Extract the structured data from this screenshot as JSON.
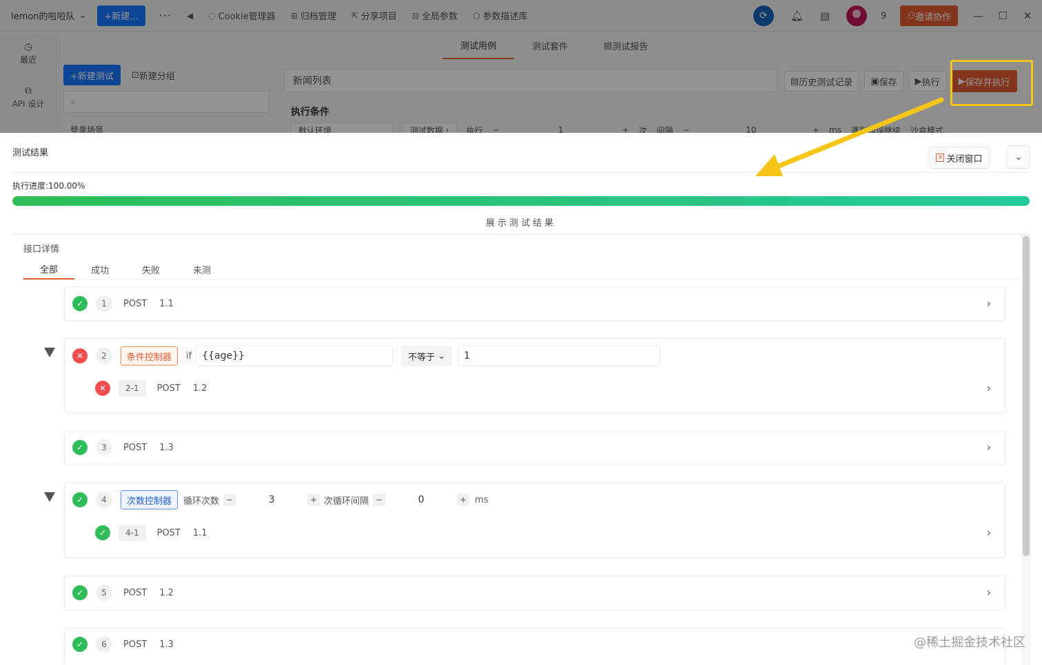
{
  "topbar": {
    "team_name": "lemon的啦啦队",
    "new_button": "+新建...",
    "more": "···",
    "nav": [
      {
        "icon": "cookie-icon",
        "glyph": "◌",
        "label": "Cookie管理器"
      },
      {
        "icon": "archive-icon",
        "glyph": "⊞",
        "label": "归档管理"
      },
      {
        "icon": "share-icon",
        "glyph": "⇱",
        "label": "分享项目"
      },
      {
        "icon": "global-params-icon",
        "glyph": "⊟",
        "label": "全局参数"
      },
      {
        "icon": "cube-icon",
        "glyph": "⬡",
        "label": "参数描述库"
      }
    ],
    "user_count": "9",
    "invite_button": "邀请协作"
  },
  "rail": {
    "items": [
      {
        "icon": "clock-icon",
        "label": "最近"
      },
      {
        "icon": "edit-icon",
        "label": "API 设计"
      }
    ]
  },
  "behind": {
    "tabs": [
      "测试用例",
      "测试套件",
      "测试报告"
    ],
    "new_test_button": "+新建测试",
    "new_group_button": "新建分组",
    "scene_item": "登录场景",
    "test_name": "新闻列表",
    "history_button": "历史测试记录",
    "save_button": "保存",
    "run_button": "执行",
    "save_run_button": "保存并执行",
    "conditions_title": "执行条件",
    "env_select": "默认环境",
    "test_data": "测试数据",
    "run_label": "执行",
    "run_times": "1",
    "times_unit": "次",
    "interval_label": "间隔",
    "interval_value": "10",
    "interval_unit": "ms",
    "continue_on_error": "遇到错误继续",
    "sandbox_mode": "沙盒模式"
  },
  "result": {
    "title": "测试结果",
    "close_button": "关闭窗口",
    "progress_label": "执行进度:100.00%",
    "progress_value": 1.0,
    "show_result": "展示测试结果",
    "detail_title": "接口详情",
    "tabs": [
      "全部",
      "成功",
      "失败",
      "未测"
    ],
    "items": [
      {
        "status": "success",
        "index": "1",
        "method": "POST",
        "name": "1.1"
      },
      {
        "status": "fail",
        "index": "2",
        "controller": "条件控制器",
        "if_label": "if",
        "condition_var": "{{age}}",
        "operator": "不等于",
        "compare_value": "1",
        "child": {
          "status": "fail",
          "index": "2-1",
          "method": "POST",
          "name": "1.2"
        }
      },
      {
        "status": "success",
        "index": "3",
        "method": "POST",
        "name": "1.3"
      },
      {
        "status": "success",
        "index": "4",
        "controller": "次数控制器",
        "loop_label": "循环次数",
        "loop_count": "3",
        "loop_interval_label": "次循环间隔",
        "loop_interval": "0",
        "unit": "ms",
        "child": {
          "status": "success",
          "index": "4-1",
          "method": "POST",
          "name": "1.1"
        }
      },
      {
        "status": "success",
        "index": "5",
        "method": "POST",
        "name": "1.2"
      },
      {
        "status": "success",
        "index": "6",
        "method": "POST",
        "name": "1.3"
      }
    ]
  },
  "watermark": "@稀土掘金技术社区",
  "colors": {
    "accent": "#e25c35",
    "primary": "#1677ff",
    "success": "#2ebd59",
    "fail": "#f24c4c",
    "highlight": "#f5c518"
  }
}
